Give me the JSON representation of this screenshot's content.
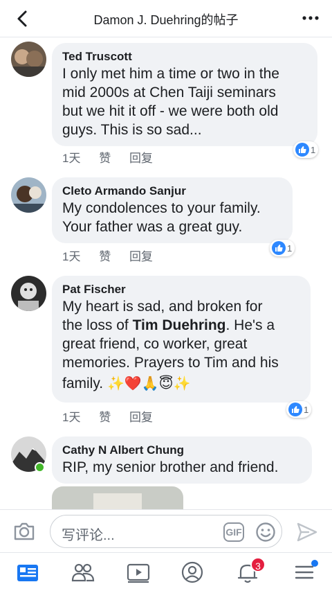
{
  "header": {
    "title": "Damon J. Duehring的帖子"
  },
  "comments": [
    {
      "author": "Ted Truscott",
      "lines": [
        "I only met him a time or two in the",
        "mid 2000s at Chen Taiji  seminars",
        "but we hit it off - we were both old",
        "guys. This is so sad..."
      ],
      "time": "1天",
      "like": "赞",
      "reply": "回复",
      "reactions": "1"
    },
    {
      "author": "Cleto Armando Sanjur",
      "lines": [
        "My condolences to your family.",
        "Your father was a great guy."
      ],
      "time": "1天",
      "like": "赞",
      "reply": "回复",
      "reactions": "1"
    },
    {
      "author": "Pat Fischer",
      "line1": "My heart is sad, and broken for",
      "line2_prefix": "the loss of ",
      "line2_bold": "Tim Duehring",
      "line2_suffix": ". He's a",
      "line3": "great friend, co worker, great",
      "line4": "memories. Prayers to Tim and his",
      "line5_text": "family. ",
      "line5_emoji": "✨❤️🙏😇✨",
      "time": "1天",
      "like": "赞",
      "reply": "回复",
      "reactions": "1"
    },
    {
      "author": "Cathy N Albert Chung",
      "lines": [
        "RIP, my senior brother and friend."
      ]
    }
  ],
  "composer": {
    "placeholder": "写评论...",
    "gif_label": "GIF"
  },
  "tabbar": {
    "notifications_badge": "3"
  },
  "colors": {
    "accent": "#1877f2",
    "bubble": "#f0f2f5",
    "badge": "#e41e3f",
    "online": "#42b72a"
  }
}
